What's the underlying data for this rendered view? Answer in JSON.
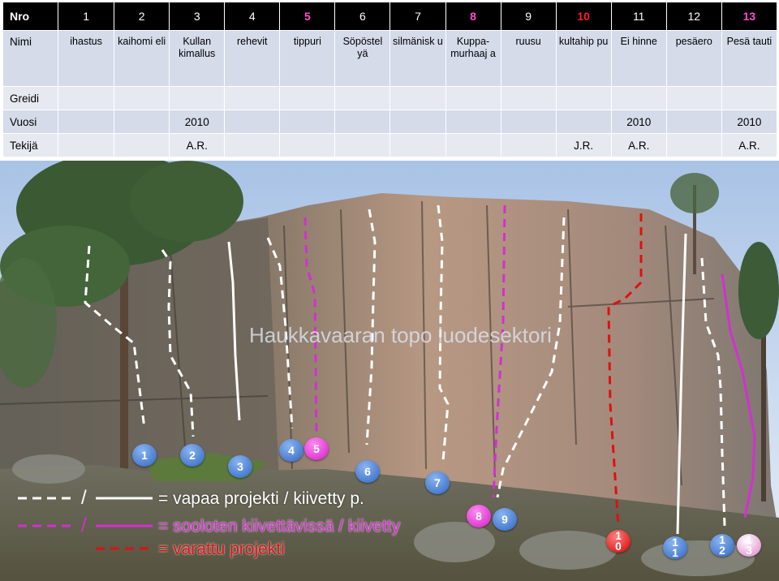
{
  "table": {
    "header_label": "Nro",
    "numbers": [
      {
        "text": "1",
        "color": "white"
      },
      {
        "text": "2",
        "color": "white"
      },
      {
        "text": "3",
        "color": "white"
      },
      {
        "text": "4",
        "color": "white"
      },
      {
        "text": "5",
        "color": "pink"
      },
      {
        "text": "6",
        "color": "white"
      },
      {
        "text": "7",
        "color": "white"
      },
      {
        "text": "8",
        "color": "pink"
      },
      {
        "text": "9",
        "color": "white"
      },
      {
        "text": "10",
        "color": "red"
      },
      {
        "text": "11",
        "color": "white"
      },
      {
        "text": "12",
        "color": "white"
      },
      {
        "text": "13",
        "color": "pink"
      }
    ],
    "name_label": "Nimi",
    "names": [
      "ihastus",
      "kaihomi eli",
      "Kullan kimallus",
      "rehevit",
      "tippuri",
      "Söpöstel yä",
      "silmänisk u",
      "Kuppa- murhaaj a",
      "ruusu",
      "kultahip pu",
      "Ei hinne",
      "pesäero",
      "Pesä tauti"
    ],
    "grade_label": "Greidi",
    "grades": [
      "",
      "",
      "",
      "",
      "",
      "",
      "",
      "",
      "",
      "",
      "",
      "",
      ""
    ],
    "year_label": "Vuosi",
    "years": [
      "",
      "",
      "2010",
      "",
      "",
      "",
      "",
      "",
      "",
      "",
      "2010",
      "",
      "2010"
    ],
    "author_label": "Tekijä",
    "authors": [
      "",
      "",
      "A.R.",
      "",
      "",
      "",
      "",
      "",
      "",
      "J.R.",
      "A.R.",
      "",
      "A.R."
    ]
  },
  "photo": {
    "title": "Haukkavaaran topo luodesektori",
    "markers": [
      {
        "label": "1",
        "style": "blue"
      },
      {
        "label": "2",
        "style": "blue"
      },
      {
        "label": "3",
        "style": "blue"
      },
      {
        "label": "4",
        "style": "blue"
      },
      {
        "label": "5",
        "style": "pink"
      },
      {
        "label": "6",
        "style": "blue"
      },
      {
        "label": "7",
        "style": "blue"
      },
      {
        "label": "8",
        "style": "pink"
      },
      {
        "label": "9",
        "style": "blue"
      },
      {
        "label": "1\n0",
        "style": "red"
      },
      {
        "label": "1\n1",
        "style": "blue"
      },
      {
        "label": "1\n2",
        "style": "blue"
      },
      {
        "label": "1\n3",
        "style": "light"
      }
    ],
    "legend": {
      "white": "= vapaa projekti / kiivetty p.",
      "pink": "= sooloten kiivettävissä / kiivetty",
      "red": "= varattu projekti"
    }
  },
  "colors": {
    "white_line": "#ffffff",
    "pink_line": "#d42fd2",
    "red_line": "#e01010",
    "header_bg": "#000000",
    "name_row_bg": "#d6dbea"
  }
}
